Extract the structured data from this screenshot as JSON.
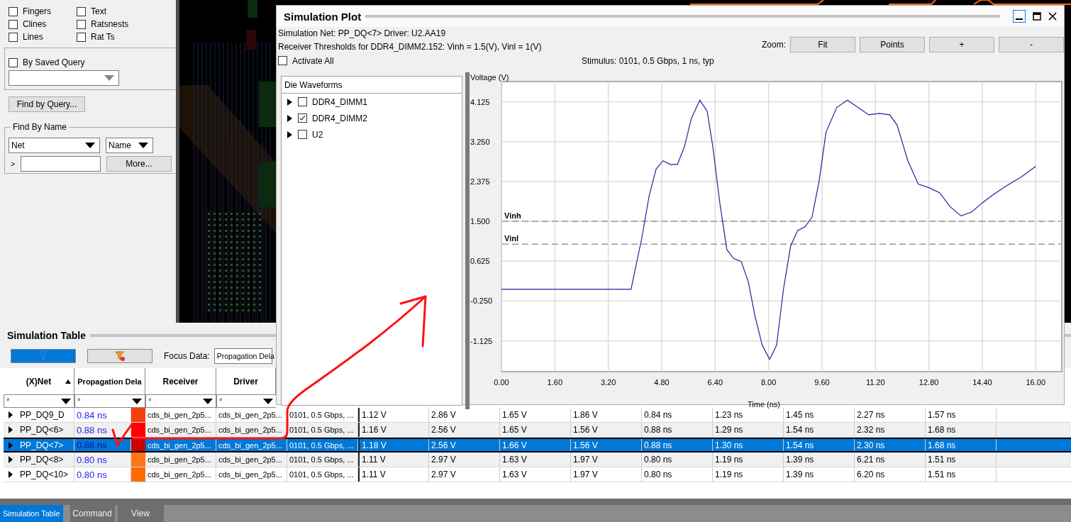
{
  "left_panel": {
    "checkboxes": [
      {
        "label": "Fingers",
        "checked": false
      },
      {
        "label": "Text",
        "checked": false
      },
      {
        "label": "Clines",
        "checked": false
      },
      {
        "label": "Ratsnests",
        "checked": false
      },
      {
        "label": "Lines",
        "checked": false
      },
      {
        "label": "Rat Ts",
        "checked": false
      }
    ],
    "saved_query": {
      "label": "By Saved Query",
      "checked": false
    },
    "find_by_query_button": "Find by Query...",
    "find_by_name": {
      "title": "Find By Name",
      "type_dropdown": "Net",
      "field_dropdown": "Name",
      "prompt": ">",
      "more_button": "More..."
    }
  },
  "simulation_plot": {
    "title": "Simulation Plot",
    "net_info": "Simulation Net: PP_DQ<7> Driver: U2.AA19",
    "thresholds": "Receiver Thresholds for DDR4_DIMM2.152: Vinh = 1.5(V), Vinl = 1(V)",
    "zoom_label": "Zoom:",
    "zoom_buttons": [
      "Fit",
      "Points",
      "+",
      "-"
    ],
    "activate_all": {
      "label": "Activate All",
      "checked": false
    },
    "stimulus": "Stimulus: 0101, 0.5 Gbps, 1 ns, typ",
    "tree": {
      "header": "Die Waveforms",
      "items": [
        {
          "label": "DDR4_DIMM1",
          "checked": false,
          "expanded": false
        },
        {
          "label": "DDR4_DIMM2",
          "checked": true,
          "expanded": false
        },
        {
          "label": "U2",
          "checked": false,
          "expanded": false
        }
      ]
    },
    "chart_data": {
      "type": "line",
      "xlabel": "Time (ns)",
      "ylabel": "Voltage (V)",
      "x": [
        0,
        3.88,
        4.2,
        4.42,
        4.63,
        4.84,
        5.05,
        5.27,
        5.48,
        5.69,
        5.94,
        6.16,
        6.33,
        6.54,
        6.75,
        6.96,
        7.18,
        7.39,
        7.6,
        7.81,
        8.03,
        8.24,
        8.45,
        8.66,
        8.87,
        9.09,
        9.3,
        9.51,
        9.72,
        10.04,
        10.36,
        10.68,
        11.0,
        11.32,
        11.63,
        11.85,
        12.17,
        12.48,
        12.8,
        13.12,
        13.44,
        13.76,
        14.07,
        14.39,
        14.71,
        15.14,
        15.56,
        16.0
      ],
      "series": [
        {
          "color": "#22229a",
          "values": [
            0.01,
            0.01,
            1.12,
            2.05,
            2.65,
            2.83,
            2.75,
            2.75,
            3.14,
            3.77,
            4.16,
            3.92,
            3.14,
            1.9,
            0.88,
            0.68,
            0.62,
            0.18,
            -0.6,
            -1.22,
            -1.53,
            -1.22,
            0.03,
            0.96,
            1.3,
            1.38,
            1.59,
            2.37,
            3.46,
            4.0,
            4.16,
            4.0,
            3.84,
            3.87,
            3.84,
            3.61,
            2.83,
            2.32,
            2.24,
            2.13,
            1.82,
            1.62,
            1.7,
            1.9,
            2.08,
            2.29,
            2.47,
            2.71
          ]
        }
      ],
      "xlim": [
        0,
        16.78
      ],
      "ylim": [
        -1.8,
        4.57
      ],
      "xticks": [
        {
          "value": 0,
          "label": "0.00"
        },
        {
          "value": 1.6,
          "label": "1.60"
        },
        {
          "value": 3.2,
          "label": "3.20"
        },
        {
          "value": 4.8,
          "label": "4.80"
        },
        {
          "value": 6.4,
          "label": "6.40"
        },
        {
          "value": 8,
          "label": "8.00"
        },
        {
          "value": 9.6,
          "label": "9.60"
        },
        {
          "value": 11.2,
          "label": "11.20"
        },
        {
          "value": 12.8,
          "label": "12.80"
        },
        {
          "value": 14.4,
          "label": "14.40"
        },
        {
          "value": 16,
          "label": "16.00"
        }
      ],
      "yticks": [
        {
          "value": 4.125,
          "label": "4.125"
        },
        {
          "value": 3.25,
          "label": "3.250"
        },
        {
          "value": 2.375,
          "label": "2.375"
        },
        {
          "value": 1.5,
          "label": "1.500"
        },
        {
          "value": 0.625,
          "label": "0.625"
        },
        {
          "value": -0.25,
          "label": "-0.250"
        },
        {
          "value": -1.125,
          "label": "-1.125"
        }
      ],
      "grid": true,
      "ref_lines": [
        {
          "axis": "y",
          "value": 1.5,
          "label": "Vinh"
        },
        {
          "axis": "y",
          "value": 1.0,
          "label": "Vinl"
        }
      ]
    }
  },
  "simulation_table": {
    "title": "Simulation Table",
    "focus_label": "Focus Data:",
    "focus_value": "Propagation Dela",
    "columns": [
      "(X)Net",
      "Propagation Dela",
      "Receiver",
      "Driver"
    ],
    "filters": [
      "*",
      "*",
      "*",
      "*"
    ],
    "rows": [
      {
        "net": "PP_DQ9_D",
        "delay": "0.84 ns",
        "color": "#f4400e",
        "receiver": "cds_bi_gen_2p5...",
        "driver": "cds_bi_gen_2p5...",
        "column_5": "0101, 0.5 Gbps, ...",
        "values": [
          "1.12 V",
          "2.86 V",
          "1.65 V",
          "1.86 V",
          "0.84 ns",
          "1.23 ns",
          "1.45 ns",
          "2.27 ns",
          "1.57 ns"
        ],
        "selected": false
      },
      {
        "net": "PP_DQ<6>",
        "delay": "0.88 ns",
        "color": "#ff0000",
        "receiver": "cds_bi_gen_2p5...",
        "driver": "cds_bi_gen_2p5...",
        "column_5": "0101, 0.5 Gbps, ...",
        "values": [
          "1.16 V",
          "2.56 V",
          "1.65 V",
          "1.56 V",
          "0.88 ns",
          "1.29 ns",
          "1.54 ns",
          "2.32 ns",
          "1.68 ns"
        ],
        "selected": false
      },
      {
        "net": "PP_DQ<7>",
        "delay": "0.88 ns",
        "color": "#ff0000",
        "receiver": "cds_bi_gen_2p5...",
        "driver": "cds_bi_gen_2p5...",
        "column_5": "0101, 0.5 Gbps, ...",
        "values": [
          "1.18 V",
          "2.56 V",
          "1.66 V",
          "1.56 V",
          "0.88 ns",
          "1.30 ns",
          "1.54 ns",
          "2.30 ns",
          "1.68 ns"
        ],
        "selected": true
      },
      {
        "net": "PP_DQ<8>",
        "delay": "0.80 ns",
        "color": "#ff7518",
        "receiver": "cds_bi_gen_2p5...",
        "driver": "cds_bi_gen_2p5...",
        "column_5": "0101, 0.5 Gbps, ...",
        "values": [
          "1.11 V",
          "2.97 V",
          "1.63 V",
          "1.97 V",
          "0.80 ns",
          "1.19 ns",
          "1.39 ns",
          "6.21 ns",
          "1.51 ns"
        ],
        "selected": false
      },
      {
        "net": "PP_DQ<10>",
        "delay": "0.80 ns",
        "color": "#ff6a00",
        "receiver": "cds_bi_gen_2p5...",
        "driver": "cds_bi_gen_2p5...",
        "column_5": "0101, 0.5 Gbps, ...",
        "values": [
          "1.11 V",
          "2.97 V",
          "1.63 V",
          "1.97 V",
          "0.80 ns",
          "1.19 ns",
          "1.39 ns",
          "6.20 ns",
          "1.51 ns"
        ],
        "selected": false
      }
    ]
  },
  "bottom_tabs": [
    {
      "label": "Simulation Table",
      "selected": true
    },
    {
      "label": "Command",
      "selected": false
    },
    {
      "label": "View",
      "selected": false
    }
  ]
}
